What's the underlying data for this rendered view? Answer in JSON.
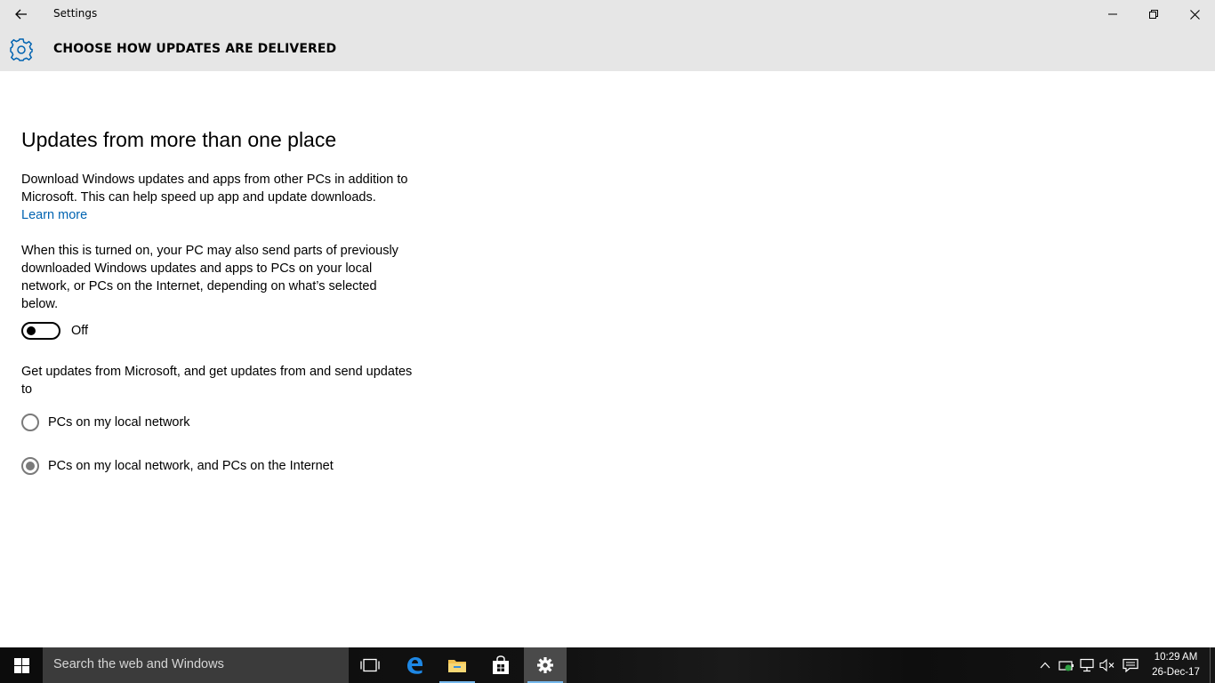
{
  "window": {
    "title": "Settings"
  },
  "header": {
    "title": "CHOOSE HOW UPDATES ARE DELIVERED"
  },
  "content": {
    "section_title": "Updates from more than one place",
    "description": "Download Windows updates and apps from other PCs in addition to Microsoft. This can help speed up app and update downloads.",
    "learn_more": "Learn more",
    "details": "When this is turned on, your PC may also send parts of previously downloaded Windows updates and apps to PCs on your local network, or PCs on the Internet, depending on what’s selected below.",
    "toggle": {
      "state": "Off",
      "on": false
    },
    "radio_group_label": "Get updates from Microsoft, and get updates from and send updates to",
    "radio_options": [
      {
        "label": "PCs on my local network",
        "selected": false
      },
      {
        "label": "PCs on my local network, and PCs on the Internet",
        "selected": true
      }
    ]
  },
  "taskbar": {
    "search_placeholder": "Search the web and Windows",
    "apps": [
      "task-view-icon",
      "edge-icon",
      "file-explorer-icon",
      "store-icon",
      "settings-icon"
    ],
    "active_app": "settings-icon",
    "tray": [
      "chevron-up-icon",
      "battery-icon",
      "network-icon",
      "volume-muted-icon",
      "action-center-icon"
    ],
    "time": "10:29 AM",
    "date": "26-Dec-17"
  },
  "colors": {
    "accent": "#0063b1",
    "titlebar_bg": "#e6e6e6",
    "taskbar_bg": "#111111"
  }
}
